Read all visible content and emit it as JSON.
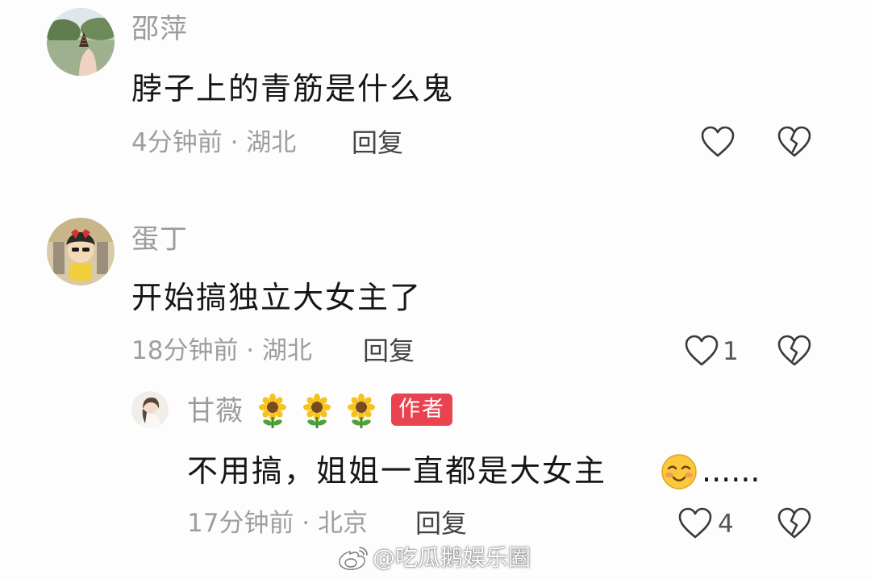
{
  "comments": [
    {
      "username": "邵萍",
      "text": "脖子上的青筋是什么鬼",
      "meta": "4分钟前 · 湖北",
      "reply_label": "回复",
      "like_count": ""
    },
    {
      "username": "蛋丁",
      "text": "开始搞独立大女主了",
      "meta": "18分钟前 · 湖北",
      "reply_label": "回复",
      "like_count": "1",
      "replies": [
        {
          "username": "甘薇",
          "badge": "作者",
          "text": "不用搞，姐姐一直都是大女主",
          "text_suffix": "......",
          "meta": "17分钟前 · 北京",
          "reply_label": "回复",
          "like_count": "4"
        }
      ]
    }
  ],
  "watermark": "@吃瓜鹅娱乐圈",
  "icons": {
    "like": "heart-outline-icon",
    "dislike": "broken-heart-icon",
    "username_emoji": "sunflower-icon",
    "text_emoji": "smiling-face-icon",
    "watermark_logo": "weibo-logo-icon"
  },
  "colors": {
    "badge": "#e8434f",
    "meta": "#9e9e9e",
    "text": "#161616"
  }
}
